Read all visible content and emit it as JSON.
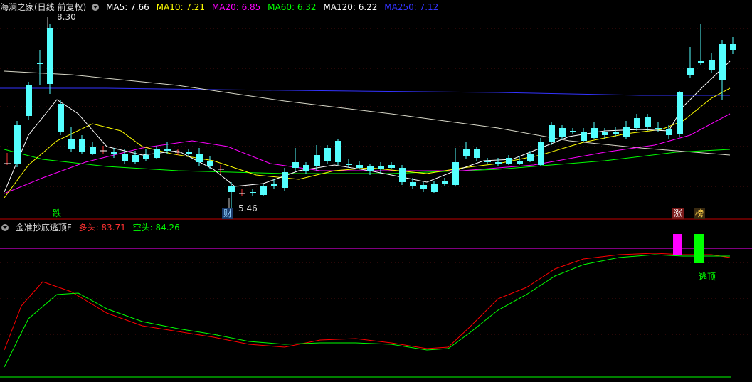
{
  "main_panel": {
    "title": "海澜之家(日线 前复权)",
    "ma_items": [
      {
        "label": "MA5: 7.66",
        "color": "#ffffff"
      },
      {
        "label": "MA10: 7.21",
        "color": "#ffff00"
      },
      {
        "label": "MA20: 6.85",
        "color": "#ff00ff"
      },
      {
        "label": "MA60: 6.32",
        "color": "#00ff00"
      },
      {
        "label": "MA120: 6.22",
        "color": "#ffffff"
      },
      {
        "label": "MA250: 7.12",
        "color": "#3333ff"
      }
    ],
    "high_label": "8.30",
    "low_label": "5.46",
    "tags": {
      "die": "跌",
      "cai": "财",
      "zhang": "涨",
      "bang": "榜"
    }
  },
  "sub_panel": {
    "title": "金准抄底逃顶F",
    "duo_label": "多头: 83.71",
    "kong_label": "空头: 84.26",
    "signal_label": "逃顶"
  },
  "colors": {
    "up": "#ff3232",
    "down": "#54ffff",
    "divider": "#c00000",
    "duo_line": "#ff0000",
    "kong_line": "#00ff00"
  }
}
